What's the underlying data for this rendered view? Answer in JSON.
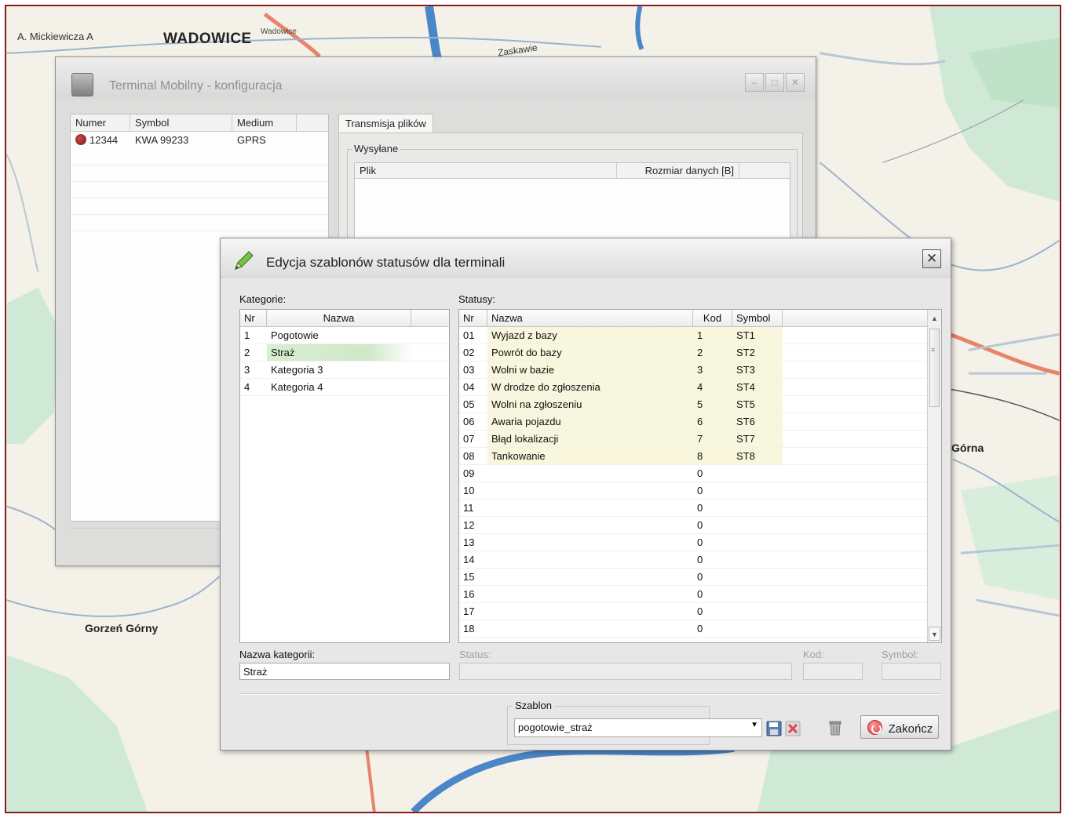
{
  "map": {
    "labels": {
      "mickiewicza": "A. Mickiewicza A",
      "wadowice": "WADOWICE",
      "wadowice_small": "Wadowice",
      "zaskawie": "Zaskawie",
      "gorna": "Górna",
      "gorzen_gorny": "Gorzeń Górny"
    },
    "colors": {
      "water": "#4a86c8",
      "road": "#e8836a",
      "land": "#f4f1e8",
      "green": "#cfe9d6"
    }
  },
  "bg_window": {
    "title": "Terminal Mobilny - konfiguracja",
    "columns": [
      "Numer",
      "Symbol",
      "Medium"
    ],
    "rows": [
      {
        "numer": "12344",
        "symbol": "KWA 99233",
        "medium": "GPRS"
      }
    ],
    "tab": "Transmisja plików",
    "group": "Wysyłane",
    "file_columns": [
      "Plik",
      "Rozmiar danych [B]"
    ]
  },
  "dialog": {
    "title": "Edycja szablonów statusów dla terminali",
    "kategorie_label": "Kategorie:",
    "kategorie_columns": [
      "Nr",
      "Nazwa"
    ],
    "kategorie": [
      {
        "nr": "1",
        "nazwa": "Pogotowie"
      },
      {
        "nr": "2",
        "nazwa": "Straż"
      },
      {
        "nr": "3",
        "nazwa": "Kategoria 3"
      },
      {
        "nr": "4",
        "nazwa": "Kategoria 4"
      }
    ],
    "statusy_label": "Statusy:",
    "statusy_columns": [
      "Nr",
      "Nazwa",
      "Kod",
      "Symbol"
    ],
    "statusy": [
      {
        "nr": "01",
        "nazwa": "Wyjazd z bazy",
        "kod": "1",
        "symbol": "ST1"
      },
      {
        "nr": "02",
        "nazwa": "Powrót do bazy",
        "kod": "2",
        "symbol": "ST2"
      },
      {
        "nr": "03",
        "nazwa": "Wolni w bazie",
        "kod": "3",
        "symbol": "ST3"
      },
      {
        "nr": "04",
        "nazwa": "W drodze do zgłoszenia",
        "kod": "4",
        "symbol": "ST4"
      },
      {
        "nr": "05",
        "nazwa": "Wolni na zgłoszeniu",
        "kod": "5",
        "symbol": "ST5"
      },
      {
        "nr": "06",
        "nazwa": "Awaria pojazdu",
        "kod": "6",
        "symbol": "ST6"
      },
      {
        "nr": "07",
        "nazwa": "Błąd lokalizacji",
        "kod": "7",
        "symbol": "ST7"
      },
      {
        "nr": "08",
        "nazwa": "Tankowanie",
        "kod": "8",
        "symbol": "ST8"
      },
      {
        "nr": "09",
        "nazwa": "",
        "kod": "0",
        "symbol": ""
      },
      {
        "nr": "10",
        "nazwa": "",
        "kod": "0",
        "symbol": ""
      },
      {
        "nr": "11",
        "nazwa": "",
        "kod": "0",
        "symbol": ""
      },
      {
        "nr": "12",
        "nazwa": "",
        "kod": "0",
        "symbol": ""
      },
      {
        "nr": "13",
        "nazwa": "",
        "kod": "0",
        "symbol": ""
      },
      {
        "nr": "14",
        "nazwa": "",
        "kod": "0",
        "symbol": ""
      },
      {
        "nr": "15",
        "nazwa": "",
        "kod": "0",
        "symbol": ""
      },
      {
        "nr": "16",
        "nazwa": "",
        "kod": "0",
        "symbol": ""
      },
      {
        "nr": "17",
        "nazwa": "",
        "kod": "0",
        "symbol": ""
      },
      {
        "nr": "18",
        "nazwa": "",
        "kod": "0",
        "symbol": ""
      }
    ],
    "nazwa_kategorii_label": "Nazwa kategorii:",
    "nazwa_kategorii_value": "Straż",
    "status_label": "Status:",
    "kod_label": "Kod:",
    "symbol_label": "Symbol:",
    "szablon_label": "Szablon",
    "szablon_value": "pogotowie_straż",
    "zakoncz_label": "Zakończ",
    "colors": {
      "selected_row": "#d2ead0",
      "filled_row": "#f8f6dc"
    }
  }
}
